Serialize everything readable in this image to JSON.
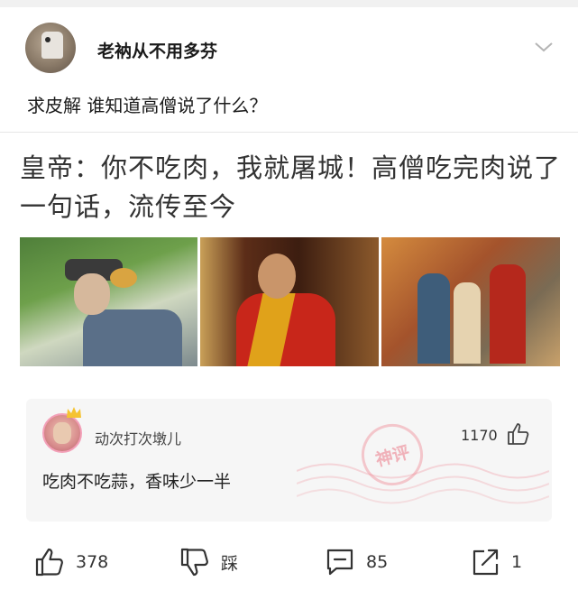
{
  "post": {
    "username": "老衲从不用多芬",
    "text": "求皮解 谁知道高僧说了什么？"
  },
  "embed": {
    "title": "皇帝：你不吃肉，我就屠城！高僧吃完肉说了一句话，流传至今"
  },
  "top_comment": {
    "username": "动次打次墩儿",
    "like_count": "1170",
    "text": "吃肉不吃蒜，香味少一半",
    "badge": "神评"
  },
  "actions": {
    "like_count": "378",
    "dislike_label": "踩",
    "comment_count": "85",
    "share_count": "1"
  },
  "icons": {
    "more": "chevron-down-icon",
    "like": "thumbs-up-icon",
    "dislike": "thumbs-down-icon",
    "comment": "comment-icon",
    "share": "share-icon"
  }
}
